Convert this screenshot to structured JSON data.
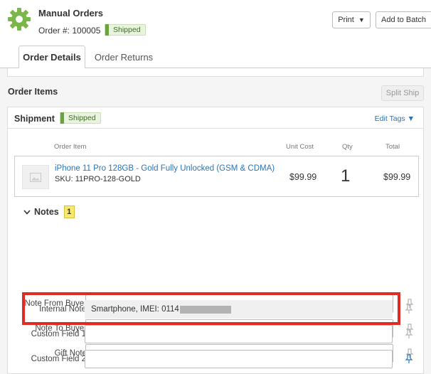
{
  "header": {
    "store_name": "Manual Orders",
    "order_label": "Order #:",
    "order_number": "100005",
    "status": "Shipped",
    "print_label": "Print",
    "add_to_batch_label": "Add to Batch"
  },
  "tabs": [
    {
      "label": "Order Details",
      "active": true
    },
    {
      "label": "Order Returns",
      "active": false
    }
  ],
  "order_items": {
    "title": "Order Items",
    "split_ship_label": "Split Ship"
  },
  "shipment": {
    "title": "Shipment",
    "status": "Shipped",
    "edit_tags_label": "Edit Tags",
    "columns": {
      "item": "Order Item",
      "unit_cost": "Unit Cost",
      "qty": "Qty",
      "total": "Total"
    },
    "item": {
      "name": "iPhone 11 Pro 128GB - Gold Fully Unlocked (GSM & CDMA)",
      "sku": "SKU: 11PRO-128-GOLD",
      "unit_cost": "$99.99",
      "qty": "1",
      "total": "$99.99"
    }
  },
  "notes": {
    "title": "Notes",
    "count": "1",
    "fields": [
      {
        "label": "Note From Buyer",
        "value": ""
      },
      {
        "label": "Note To Buyer",
        "value": ""
      },
      {
        "label": "Gift Note",
        "value": ""
      },
      {
        "label": "Internal Note",
        "value": "Smartphone, IMEI: 0114"
      },
      {
        "label": "Custom Field 1",
        "value": ""
      },
      {
        "label": "Custom Field 2",
        "value": ""
      }
    ]
  },
  "colors": {
    "accent_blue": "#2a74b8",
    "gear_green": "#7ab648",
    "shipped_green": "#6aa33f",
    "highlight_red": "#e02b22",
    "notes_badge_yellow": "#f6e96d"
  }
}
